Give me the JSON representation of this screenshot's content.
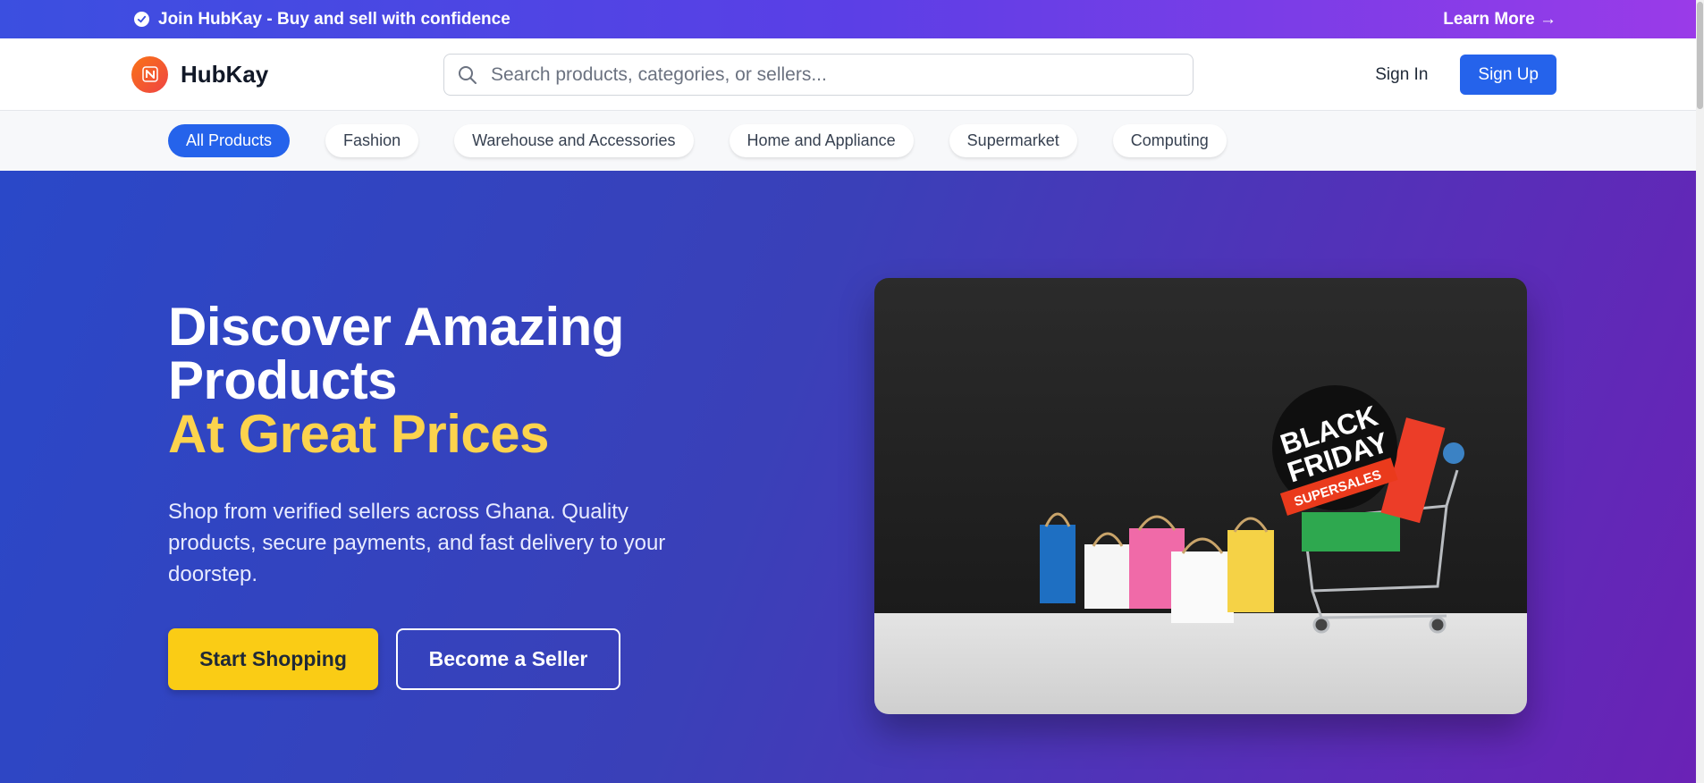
{
  "announcement": {
    "text": "Join HubKay - Buy and sell with confidence",
    "link_label": "Learn More →"
  },
  "header": {
    "brand": "HubKay",
    "search_placeholder": "Search products, categories, or sellers...",
    "signin_label": "Sign In",
    "signup_label": "Sign Up"
  },
  "categories": [
    {
      "label": "All Products",
      "active": true
    },
    {
      "label": "Fashion",
      "active": false
    },
    {
      "label": "Warehouse and Accessories",
      "active": false
    },
    {
      "label": "Home and Appliance",
      "active": false
    },
    {
      "label": "Supermarket",
      "active": false
    },
    {
      "label": "Computing",
      "active": false
    }
  ],
  "hero": {
    "title_line1": "Discover Amazing",
    "title_line2": "Products",
    "title_accent": "At Great Prices",
    "subtitle": "Shop from verified sellers across Ghana. Quality products, secure payments, and fast delivery to your doorstep.",
    "primary_cta": "Start Shopping",
    "secondary_cta": "Become a Seller",
    "image": {
      "badge_line1": "BLACK",
      "badge_line2": "FRIDAY",
      "ribbon_text": "SUPERSALES"
    }
  },
  "colors": {
    "accent_blue": "#2563eb",
    "accent_yellow": "#facc15",
    "title_highlight": "#fcd34d"
  }
}
